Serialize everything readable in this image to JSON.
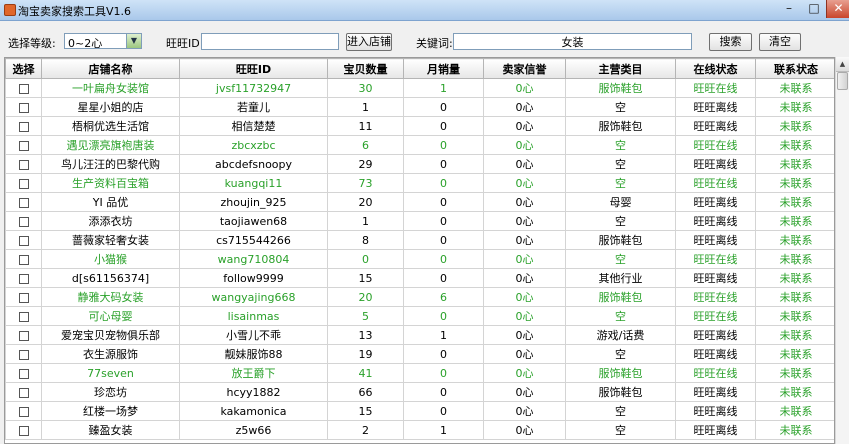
{
  "window": {
    "title": "淘宝卖家搜索工具V1.6",
    "minimize": "–",
    "maximize": "□",
    "close": "✕"
  },
  "toolbar": {
    "level_label": "选择等级:",
    "level_value": "0~2心",
    "wangwang_label": "旺旺ID:",
    "wangwang_value": "",
    "enter_shop_button": "进入店铺",
    "keyword_label": "关键词:",
    "keyword_value": "女装",
    "search_button": "搜索",
    "clear_button": "清空"
  },
  "table": {
    "columns": [
      "选择",
      "店铺名称",
      "旺旺ID",
      "宝贝数量",
      "月销量",
      "卖家信誉",
      "主营类目",
      "在线状态",
      "联系状态"
    ],
    "rows": [
      {
        "shop": "一叶扁舟女装馆",
        "id": "jvsf11732947",
        "items": "30",
        "sales": "1",
        "credit": "0心",
        "category": "服饰鞋包",
        "online": "旺旺在线",
        "contact": "未联系",
        "green": true
      },
      {
        "shop": "星星小姐的店",
        "id": "若童儿",
        "items": "1",
        "sales": "0",
        "credit": "0心",
        "category": "空",
        "online": "旺旺离线",
        "contact": "未联系",
        "green": false
      },
      {
        "shop": "梧桐优选生活馆",
        "id": "相信楚楚",
        "items": "11",
        "sales": "0",
        "credit": "0心",
        "category": "服饰鞋包",
        "online": "旺旺离线",
        "contact": "未联系",
        "green": false
      },
      {
        "shop": "遇见漂亮旗袍唐装",
        "id": "zbcxzbc",
        "items": "6",
        "sales": "0",
        "credit": "0心",
        "category": "空",
        "online": "旺旺在线",
        "contact": "未联系",
        "green": true
      },
      {
        "shop": "鸟儿汪汪的巴黎代购",
        "id": "abcdefsnoopy",
        "items": "29",
        "sales": "0",
        "credit": "0心",
        "category": "空",
        "online": "旺旺离线",
        "contact": "未联系",
        "green": false
      },
      {
        "shop": "生产资料百宝箱",
        "id": "kuangqi11",
        "items": "73",
        "sales": "0",
        "credit": "0心",
        "category": "空",
        "online": "旺旺在线",
        "contact": "未联系",
        "green": true
      },
      {
        "shop": "YI 品优",
        "id": "zhoujin_925",
        "items": "20",
        "sales": "0",
        "credit": "0心",
        "category": "母婴",
        "online": "旺旺离线",
        "contact": "未联系",
        "green": false
      },
      {
        "shop": "添添衣坊",
        "id": "taojiawen68",
        "items": "1",
        "sales": "0",
        "credit": "0心",
        "category": "空",
        "online": "旺旺离线",
        "contact": "未联系",
        "green": false
      },
      {
        "shop": "蔷薇家轻奢女装",
        "id": "cs715544266",
        "items": "8",
        "sales": "0",
        "credit": "0心",
        "category": "服饰鞋包",
        "online": "旺旺离线",
        "contact": "未联系",
        "green": false
      },
      {
        "shop": "小猫猴",
        "id": "wang710804",
        "items": "0",
        "sales": "0",
        "credit": "0心",
        "category": "空",
        "online": "旺旺在线",
        "contact": "未联系",
        "green": true
      },
      {
        "shop": "d[s61156374]",
        "id": "follow9999",
        "items": "15",
        "sales": "0",
        "credit": "0心",
        "category": "其他行业",
        "online": "旺旺离线",
        "contact": "未联系",
        "green": false
      },
      {
        "shop": "静雅大码女装",
        "id": "wangyajing668",
        "items": "20",
        "sales": "6",
        "credit": "0心",
        "category": "服饰鞋包",
        "online": "旺旺在线",
        "contact": "未联系",
        "green": true
      },
      {
        "shop": "可心母婴",
        "id": "lisainmas",
        "items": "5",
        "sales": "0",
        "credit": "0心",
        "category": "空",
        "online": "旺旺在线",
        "contact": "未联系",
        "green": true
      },
      {
        "shop": "爱宠宝贝宠物俱乐部",
        "id": "小雪儿不乖",
        "items": "13",
        "sales": "1",
        "credit": "0心",
        "category": "游戏/话费",
        "online": "旺旺离线",
        "contact": "未联系",
        "green": false
      },
      {
        "shop": "衣生源服饰",
        "id": "靓妹服饰88",
        "items": "19",
        "sales": "0",
        "credit": "0心",
        "category": "空",
        "online": "旺旺离线",
        "contact": "未联系",
        "green": false
      },
      {
        "shop": "77seven",
        "id": "放王爵下",
        "items": "41",
        "sales": "0",
        "credit": "0心",
        "category": "服饰鞋包",
        "online": "旺旺在线",
        "contact": "未联系",
        "green": true
      },
      {
        "shop": "珍恋坊",
        "id": "hcyy1882",
        "items": "66",
        "sales": "0",
        "credit": "0心",
        "category": "服饰鞋包",
        "online": "旺旺离线",
        "contact": "未联系",
        "green": false
      },
      {
        "shop": "红楼一场梦",
        "id": "kakamonica",
        "items": "15",
        "sales": "0",
        "credit": "0心",
        "category": "空",
        "online": "旺旺离线",
        "contact": "未联系",
        "green": false
      },
      {
        "shop": "臻盈女装",
        "id": "z5w66",
        "items": "2",
        "sales": "1",
        "credit": "0心",
        "category": "空",
        "online": "旺旺离线",
        "contact": "未联系",
        "green": false
      }
    ]
  },
  "scrollbar": {
    "up_arrow": "▲"
  },
  "icons": {
    "dropdown": "chevron-down-icon",
    "app": "app-icon"
  },
  "colors": {
    "online_row_text": "#2aa12a",
    "contact_status_text": "#2aa12a"
  }
}
